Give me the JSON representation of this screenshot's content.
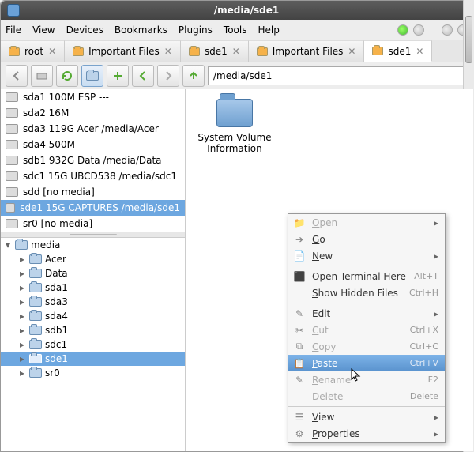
{
  "window": {
    "title": "/media/sde1"
  },
  "menubar": [
    "File",
    "View",
    "Devices",
    "Bookmarks",
    "Plugins",
    "Tools",
    "Help"
  ],
  "tabs": [
    {
      "label": "root",
      "active": false
    },
    {
      "label": "Important Files",
      "active": false
    },
    {
      "label": "sde1",
      "active": false
    },
    {
      "label": "Important Files",
      "active": false
    },
    {
      "label": "sde1",
      "active": true
    }
  ],
  "address": "/media/sde1",
  "devices": [
    {
      "label": "sda1 100M ESP ---",
      "sel": false
    },
    {
      "label": "sda2 16M",
      "sel": false
    },
    {
      "label": "sda3 119G Acer /media/Acer",
      "sel": false
    },
    {
      "label": "sda4 500M ---",
      "sel": false
    },
    {
      "label": "sdb1 932G Data /media/Data",
      "sel": false
    },
    {
      "label": "sdc1 15G UBCD538 /media/sdc1",
      "sel": false
    },
    {
      "label": "sdd [no media]",
      "sel": false
    },
    {
      "label": "sde1 15G CAPTURES /media/sde1",
      "sel": true
    },
    {
      "label": "sr0 [no media]",
      "sel": false
    }
  ],
  "tree": {
    "root": "media",
    "nodes": [
      {
        "label": "Acer",
        "sel": false
      },
      {
        "label": "Data",
        "sel": false
      },
      {
        "label": "sda1",
        "sel": false
      },
      {
        "label": "sda3",
        "sel": false
      },
      {
        "label": "sda4",
        "sel": false
      },
      {
        "label": "sdb1",
        "sel": false
      },
      {
        "label": "sdc1",
        "sel": false
      },
      {
        "label": "sde1",
        "sel": true
      },
      {
        "label": "sr0",
        "sel": false
      }
    ]
  },
  "content_items": [
    {
      "label": "System Volume Information"
    }
  ],
  "context_menu": [
    {
      "type": "item",
      "label": "Open",
      "icon": "folder",
      "disabled": true,
      "submenu": true,
      "accel": ""
    },
    {
      "type": "item",
      "label": "Go",
      "icon": "go",
      "disabled": false,
      "submenu": false,
      "accel": ""
    },
    {
      "type": "item",
      "label": "New",
      "icon": "doc",
      "disabled": false,
      "submenu": true,
      "accel": ""
    },
    {
      "type": "sep"
    },
    {
      "type": "item",
      "label": "Open Terminal Here",
      "icon": "term",
      "disabled": false,
      "submenu": false,
      "accel": "Alt+T"
    },
    {
      "type": "item",
      "label": "Show Hidden Files",
      "icon": "",
      "disabled": false,
      "submenu": false,
      "accel": "Ctrl+H"
    },
    {
      "type": "sep"
    },
    {
      "type": "item",
      "label": "Edit",
      "icon": "edit",
      "disabled": false,
      "submenu": true,
      "accel": ""
    },
    {
      "type": "item",
      "label": "Cut",
      "icon": "cut",
      "disabled": true,
      "submenu": false,
      "accel": "Ctrl+X"
    },
    {
      "type": "item",
      "label": "Copy",
      "icon": "copy",
      "disabled": true,
      "submenu": false,
      "accel": "Ctrl+C"
    },
    {
      "type": "item",
      "label": "Paste",
      "icon": "paste",
      "disabled": false,
      "submenu": false,
      "accel": "Ctrl+V",
      "sel": true
    },
    {
      "type": "item",
      "label": "Rename",
      "icon": "rename",
      "disabled": true,
      "submenu": false,
      "accel": "F2"
    },
    {
      "type": "item",
      "label": "Delete",
      "icon": "",
      "disabled": true,
      "submenu": false,
      "accel": "Delete"
    },
    {
      "type": "sep"
    },
    {
      "type": "item",
      "label": "View",
      "icon": "view",
      "disabled": false,
      "submenu": true,
      "accel": ""
    },
    {
      "type": "item",
      "label": "Properties",
      "icon": "props",
      "disabled": false,
      "submenu": true,
      "accel": ""
    }
  ]
}
